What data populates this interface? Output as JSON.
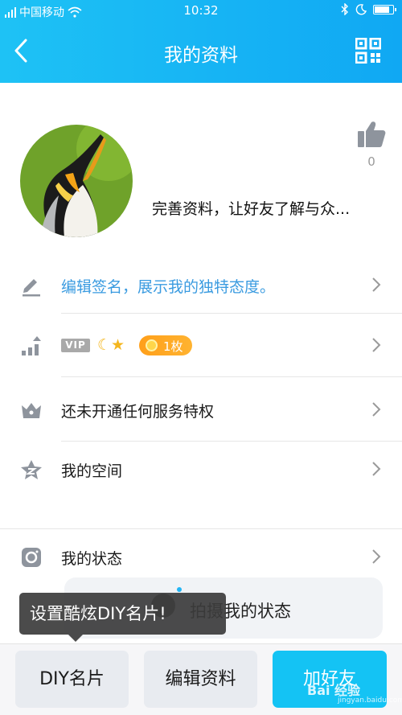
{
  "status_bar": {
    "carrier": "中国移动",
    "time": "10:32"
  },
  "header": {
    "title": "我的资料"
  },
  "profile": {
    "like_count": "0",
    "description": "完善资料，让好友了解与众..."
  },
  "rows": {
    "signature": "编辑签名，展示我的独特态度。",
    "vip": {
      "tag": "VIP",
      "badge": "1枚"
    },
    "privilege": "还未开通任何服务特权",
    "qzone": "我的空间",
    "status": "我的状态"
  },
  "post_box": {
    "label": "拍摄我的状态"
  },
  "tooltip": {
    "text": "设置酷炫DIY名片!"
  },
  "bottom_bar": {
    "diy": "DIY名片",
    "edit": "编辑资料",
    "add_friend": "加好友"
  },
  "watermark": {
    "text": "Bai 经验",
    "sub": "jingyan.baidu.com"
  },
  "colors": {
    "header": "#10a8f3",
    "accent": "#14c3f4",
    "link_blue": "#3a9be0",
    "badge_orange": "#ff9f1a"
  }
}
